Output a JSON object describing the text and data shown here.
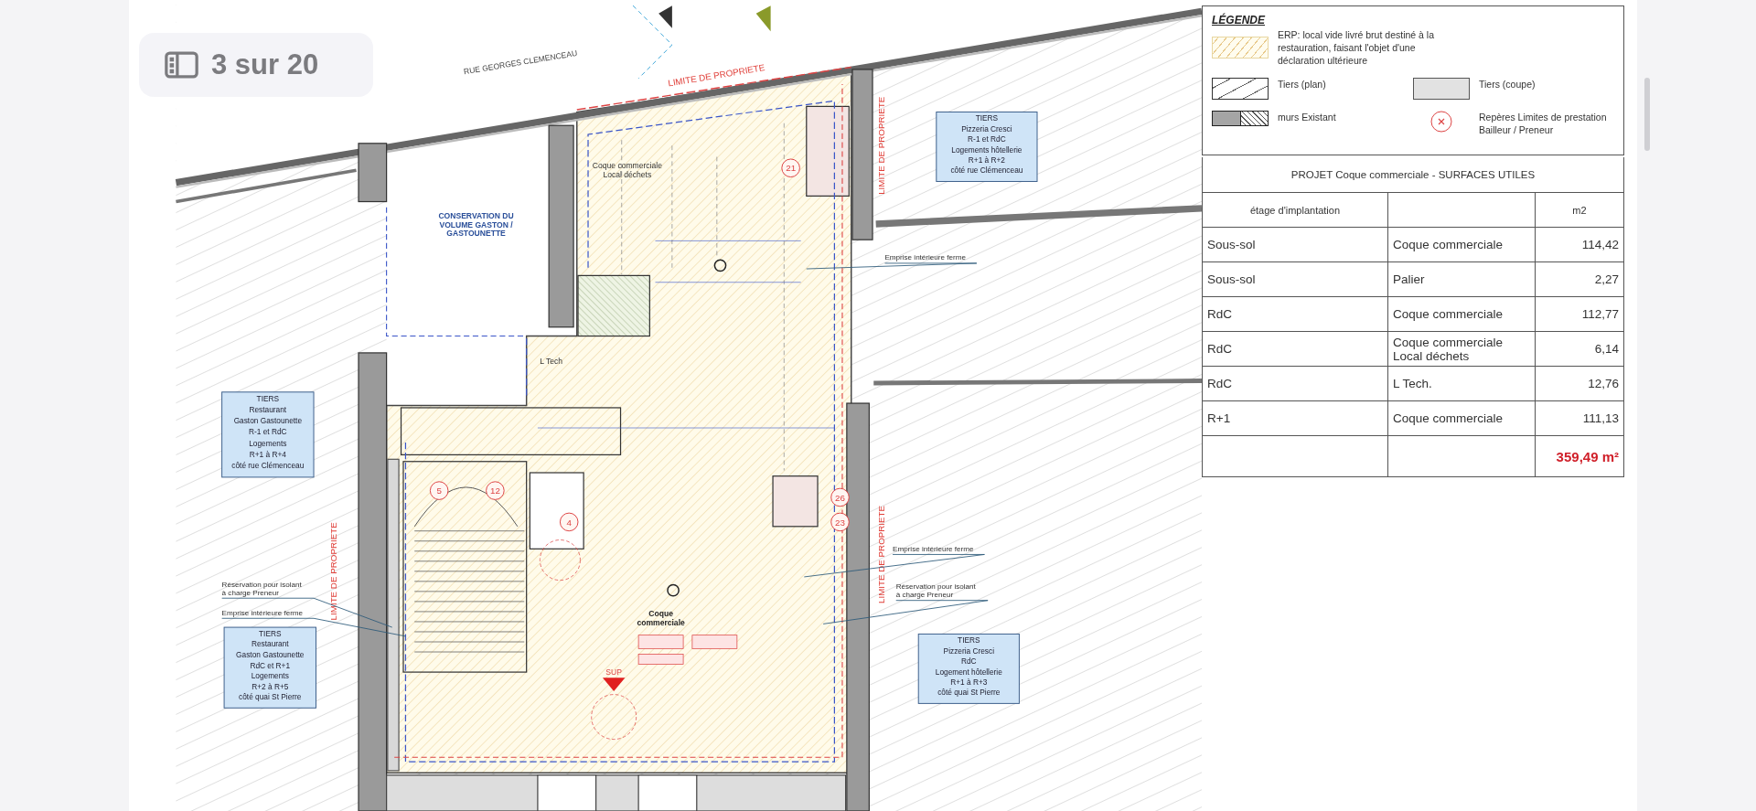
{
  "viewer": {
    "counter": "3 sur 20"
  },
  "plan": {
    "street_name": "RUE GEORGES CLEMENCEAU",
    "property_limits": [
      "LIMITE DE PROPRIETE",
      "LIMITE DE PROPRIETE",
      "LIMITE DE PROPRIETE",
      "LIMITE DE PROPRIETE"
    ],
    "rooms": [
      {
        "lines": [
          "CONSERVATION DU",
          "VOLUME GASTON /",
          "GASTOUNETTE"
        ]
      },
      {
        "lines": [
          "Coque commerciale",
          "Local déchets"
        ]
      },
      {
        "lines": [
          "L Tech"
        ]
      },
      {
        "lines": [
          "Coque",
          "commerciale"
        ]
      }
    ],
    "tenants": [
      {
        "lines": [
          "TIERS",
          "Restaurant",
          "Gaston Gastounette",
          "R-1 et RdC",
          "Logements",
          "R+1 à R+4",
          "côté rue Clémenceau"
        ]
      },
      {
        "lines": [
          "TIERS",
          "Restaurant",
          "Gaston Gastounette",
          "RdC et R+1",
          "Logements",
          "R+2 à R+5",
          "côté quai St Pierre"
        ]
      },
      {
        "lines": [
          "TIERS",
          "Pizzeria Cresci",
          "R-1 et RdC",
          "Logements hôtellerie",
          "R+1 à R+2",
          "côté rue Clémenceau"
        ]
      },
      {
        "lines": [
          "TIERS",
          "Pizzeria Cresci",
          "RdC",
          "Logement hôtellerie",
          "R+1 à R+3",
          "côté quai St Pierre"
        ]
      }
    ],
    "notes": [
      {
        "lines": [
          "Emprise intérieure ferme"
        ]
      },
      {
        "lines": [
          "Emprise intérieure ferme"
        ]
      },
      {
        "lines": [
          "Réservation pour isolant",
          "à charge Preneur"
        ]
      },
      {
        "lines": [
          "Réservation pour isolant",
          "à charge Preneur"
        ]
      },
      {
        "lines": [
          "Emprise intérieure ferme"
        ]
      }
    ],
    "markers": [
      "21",
      "5",
      "12",
      "4",
      "26",
      "23"
    ],
    "entrance": "SUP"
  },
  "legend": {
    "title": "LÉGENDE",
    "items": [
      {
        "kind": "erp",
        "label": "ERP: local vide livré brut destiné à la restauration, faisant l'objet d'une déclaration ultérieure"
      },
      {
        "kind": "tiers-plan",
        "label": "Tiers (plan)"
      },
      {
        "kind": "tiers-coupe",
        "label": "Tiers (coupe)"
      },
      {
        "kind": "murs",
        "label": "murs Existant"
      },
      {
        "kind": "repere",
        "label": "Repères Limites de prestation Bailleur / Preneur"
      }
    ]
  },
  "table": {
    "title": "PROJET Coque commerciale - SURFACES UTILES",
    "header": {
      "floor": "étage d'implantation",
      "area": "m2"
    },
    "rows": [
      {
        "floor": "Sous-sol",
        "space": [
          "Coque commerciale"
        ],
        "area": "114,42"
      },
      {
        "floor": "Sous-sol",
        "space": [
          "Palier"
        ],
        "area": "2,27"
      },
      {
        "floor": "RdC",
        "space": [
          "Coque commerciale"
        ],
        "area": "112,77"
      },
      {
        "floor": "RdC",
        "space": [
          "Coque commerciale",
          "Local déchets"
        ],
        "area": "6,14"
      },
      {
        "floor": "RdC",
        "space": [
          "L Tech."
        ],
        "area": "12,76"
      },
      {
        "floor": "R+1",
        "space": [
          "Coque commerciale"
        ],
        "area": "111,13"
      }
    ],
    "total": "359,49 m²"
  }
}
